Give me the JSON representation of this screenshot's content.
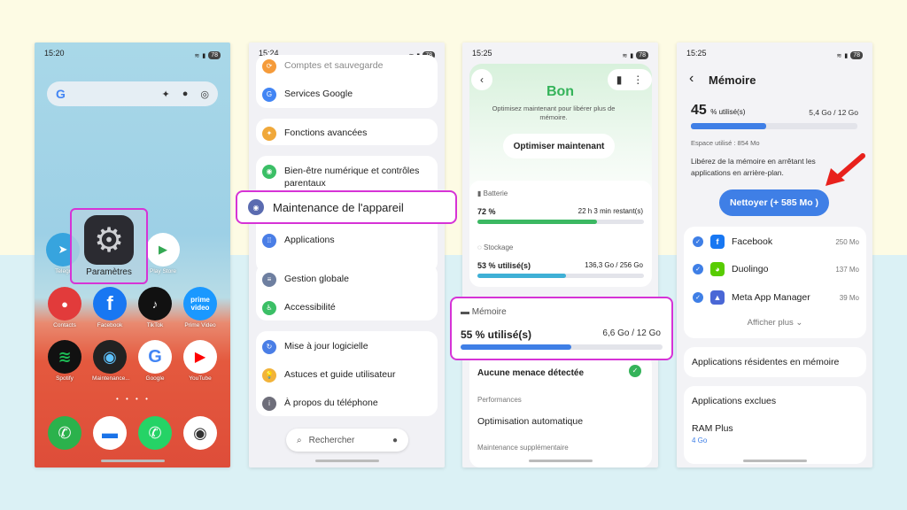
{
  "phone1": {
    "time": "15:20",
    "battery": "78",
    "google_letter": "G",
    "apps_row1": [
      "Telegr",
      "Play Store"
    ],
    "settings_label": "Paramètres",
    "apps_row2": [
      "Contacts",
      "Facebook",
      "TikTok",
      "Prime Video"
    ],
    "apps_row3": [
      "Spotify",
      "Maintenance...",
      "Google",
      "YouTube"
    ],
    "prime_text": "prime video"
  },
  "phone2": {
    "time": "15:24",
    "battery": "78",
    "items": [
      "Comptes et sauvegarde",
      "Services Google",
      "Fonctions avancées",
      "Bien-être numérique et contrôles parentaux",
      "Maintenance de l'appareil",
      "Applications",
      "Gestion globale",
      "Accessibilité",
      "Mise à jour logicielle",
      "Astuces et guide utilisateur",
      "À propos du téléphone"
    ],
    "search_placeholder": "Rechercher"
  },
  "phone3": {
    "time": "15:25",
    "battery": "78",
    "status": "Bon",
    "subtitle": "Optimisez maintenant pour libérer plus de mémoire.",
    "optimize_button": "Optimiser maintenant",
    "battery_label": "Batterie",
    "battery_value": "72 %",
    "battery_remaining": "22 h 3 min restant(s)",
    "battery_fill": 0.72,
    "storage_label": "Stockage",
    "storage_value": "53 % utilisé(s)",
    "storage_detail": "136,3 Go / 256 Go",
    "storage_fill": 0.53,
    "memory_label": "Mémoire",
    "memory_value": "55 % utilisé(s)",
    "memory_detail": "6,6 Go / 12 Go",
    "memory_fill": 0.55,
    "threat_text": "Aucune menace détectée",
    "performance_header": "Performances",
    "auto_opt": "Optimisation automatique",
    "extra_header": "Maintenance supplémentaire"
  },
  "phone4": {
    "time": "15:25",
    "battery": "78",
    "title": "Mémoire",
    "percent": "45",
    "percent_suffix": "% utilisé(s)",
    "usage_detail": "5,4 Go / 12 Go",
    "usage_fill": 0.45,
    "used_space": "Espace utilisé : 854 Mo",
    "description": "Libérez de la mémoire en arrêtant les applications en arrière-plan.",
    "clean_button": "Nettoyer (+ 585 Mo )",
    "apps": [
      {
        "name": "Facebook",
        "size": "250 Mo"
      },
      {
        "name": "Duolingo",
        "size": "137 Mo"
      },
      {
        "name": "Meta App Manager",
        "size": "39 Mo"
      }
    ],
    "show_more": "Afficher plus",
    "resident_apps": "Applications résidentes en mémoire",
    "excluded_apps": "Applications exclues",
    "ram_plus": "RAM Plus",
    "ram_plus_value": "4 Go"
  },
  "colors": {
    "highlight": "#d633d6",
    "accent": "#3f7fe6",
    "good": "#35b35a",
    "arrow": "#e8211c"
  }
}
